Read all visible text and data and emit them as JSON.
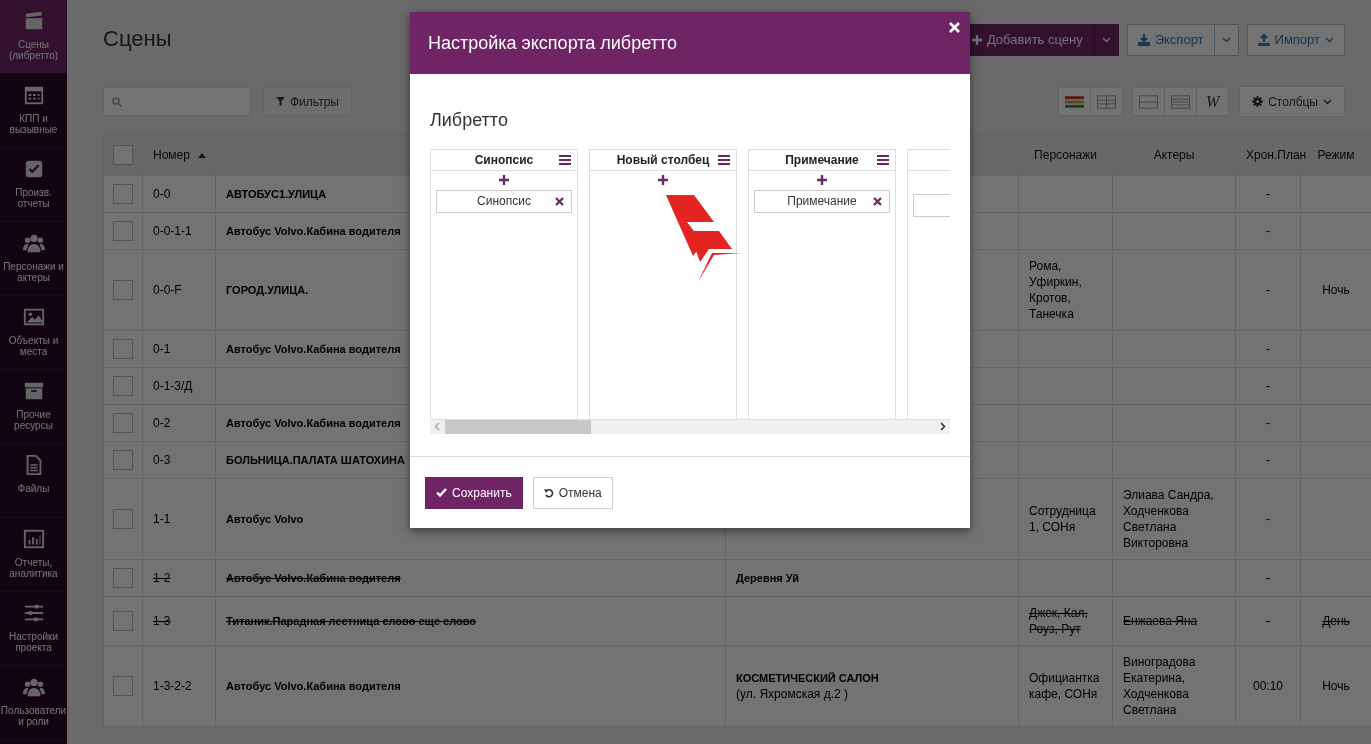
{
  "sidebar": {
    "items": [
      {
        "label": "Сцены (либретто)",
        "selected": true
      },
      {
        "label": "КПП и вызывные",
        "selected": false
      },
      {
        "label": "Произв. отчеты",
        "selected": false
      },
      {
        "label": "Персонажи и актеры",
        "selected": false
      },
      {
        "label": "Объекты и места",
        "selected": false
      },
      {
        "label": "Прочие ресурсы",
        "selected": false
      },
      {
        "label": "Файлы",
        "selected": false
      },
      {
        "label": "Отчеты, аналитика",
        "selected": false
      },
      {
        "label": "Настройки проекта",
        "selected": false
      },
      {
        "label": "Пользователи и роли",
        "selected": false
      }
    ]
  },
  "page": {
    "title": "Сцены",
    "actions": [
      {
        "kind": "primary",
        "label": "Добавить сцену",
        "split": true
      },
      {
        "kind": "outline",
        "label": "Экспорт",
        "split": true
      },
      {
        "kind": "outline",
        "label": "Импорт",
        "split": false
      }
    ]
  },
  "toolbar": {
    "filter_button": "Фильтры",
    "wrap_button": "W",
    "columns_button": "Столбцы"
  },
  "table": {
    "header_checked": false,
    "columns": [
      {
        "kind": "check"
      },
      {
        "kind": "text",
        "label": "Номер",
        "sorted": true
      },
      {
        "kind": "text"
      },
      {
        "kind": "text"
      },
      {
        "kind": "text",
        "label": "Персонажи"
      },
      {
        "kind": "text",
        "label": "Актеры"
      },
      {
        "kind": "text",
        "label": "Хрон.План"
      },
      {
        "kind": "text",
        "label": "Режим"
      }
    ],
    "rows": [
      {
        "checked": false,
        "deleted": false,
        "number": "0-0",
        "scene": "АВТОБУС1.УЛИЦА",
        "chron_plan": "-"
      },
      {
        "checked": false,
        "deleted": false,
        "number": "0-0-1-1",
        "scene": "Автобус Volvo.Кабина водителя",
        "chron_plan": "-"
      },
      {
        "checked": false,
        "deleted": false,
        "number": "0-0-F",
        "scene": "ГОРОД.УЛИЦА.",
        "characters": "Рома, Уфиркин, Кротов, Танечка",
        "chron_plan": "-",
        "mode": "Ночь"
      },
      {
        "checked": false,
        "deleted": false,
        "number": "0-1",
        "scene": "Автобус Volvo.Кабина водителя",
        "chron_plan": "-"
      },
      {
        "checked": false,
        "deleted": false,
        "number": "0-1-3/Д",
        "chron_plan": "-"
      },
      {
        "checked": false,
        "deleted": false,
        "number": "0-2",
        "scene": "Автобус Volvo.Кабина водителя",
        "chron_plan": "-"
      },
      {
        "checked": false,
        "deleted": false,
        "number": "0-3",
        "scene": "БОЛЬНИЦА.ПАЛАТА ШАТОХИНА",
        "chron_plan": "-"
      },
      {
        "checked": false,
        "deleted": false,
        "number": "1-1",
        "scene": "Автобус Volvo",
        "characters": "Сотрудница 1, СОНя",
        "actors": "Элиава Сандра, Ходченкова Светлана Викторовна",
        "chron_plan": "-"
      },
      {
        "checked": false,
        "deleted": true,
        "number": "1-2",
        "scene": "Автобус Volvo.Кабина водителя",
        "location": "Деревня Уй",
        "chron_plan": "-"
      },
      {
        "checked": false,
        "deleted": true,
        "number": "1-3",
        "scene": "Титаник.Парадная лестница слово еще слово",
        "characters": "Джек, Кал, Роуз, Рут",
        "actors": "Енжаева Яна",
        "chron_plan": "-",
        "mode": "День"
      },
      {
        "checked": false,
        "deleted": false,
        "number": "1-3-2-2",
        "scene": "Автобус Volvo.Кабина водителя",
        "location": "КОСМЕТИЧЕСКИЙ САЛОН",
        "location_address": "(ул. Яхромская д.2 )",
        "characters": "Официантка кафе, СОНя",
        "actors": "Виноградова Екатерина, Ходченкова Светлана",
        "chron_plan": "00:10",
        "mode": "Ночь"
      }
    ]
  },
  "modal": {
    "title": "Настройка экспорта либретто",
    "section": "Либретто",
    "columns": [
      {
        "title": "Синопсис",
        "items": [
          {
            "label": "Синопсис"
          }
        ]
      },
      {
        "title": "Новый столбец"
      },
      {
        "title": "Примечание",
        "items": [
          {
            "label": "Примечание"
          }
        ]
      },
      {
        "kind": "partial"
      }
    ],
    "save_button": "Сохранить",
    "cancel_button": "Отмена"
  }
}
